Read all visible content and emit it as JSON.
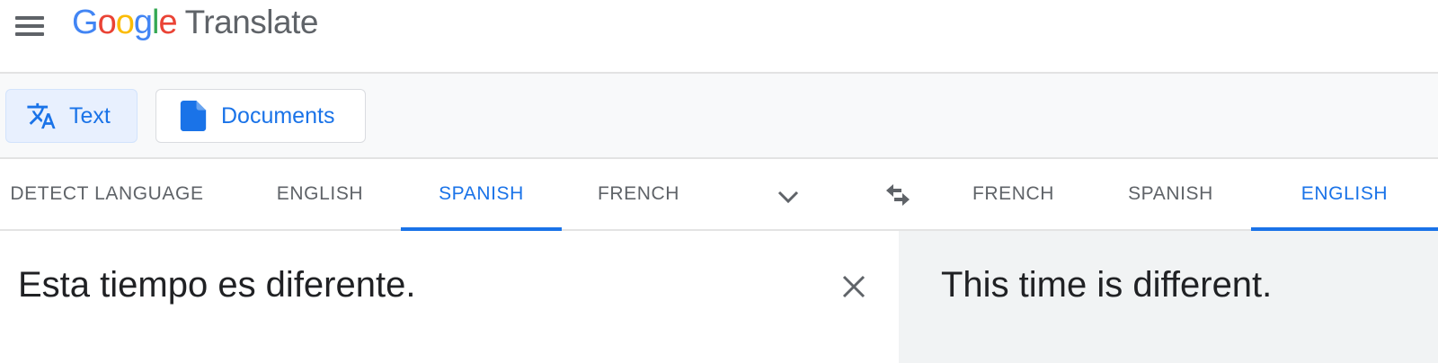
{
  "header": {
    "logo_letters": [
      "G",
      "o",
      "o",
      "g",
      "l",
      "e"
    ],
    "product_name": "Translate",
    "menu_icon": "hamburger-menu-icon"
  },
  "modes": [
    {
      "label": "Text",
      "icon": "translate-icon",
      "selected": true
    },
    {
      "label": "Documents",
      "icon": "document-icon",
      "selected": false
    }
  ],
  "source_languages": {
    "tabs": [
      {
        "label": "DETECT LANGUAGE",
        "active": false
      },
      {
        "label": "ENGLISH",
        "active": false
      },
      {
        "label": "SPANISH",
        "active": true
      },
      {
        "label": "FRENCH",
        "active": false
      }
    ],
    "more_icon": "chevron-down-icon"
  },
  "swap_icon": "swap-arrows-icon",
  "target_languages": {
    "tabs": [
      {
        "label": "FRENCH",
        "active": false
      },
      {
        "label": "SPANISH",
        "active": false
      },
      {
        "label": "ENGLISH",
        "active": true
      }
    ]
  },
  "source": {
    "text": "Esta tiempo es diferente.",
    "clear_icon": "close-icon"
  },
  "target": {
    "text": "This time is different."
  },
  "colors": {
    "accent": "#1a73e8",
    "tab_text": "#5f6368",
    "output_bg": "#f1f3f4",
    "mode_selected_bg": "#e8f0fe"
  }
}
